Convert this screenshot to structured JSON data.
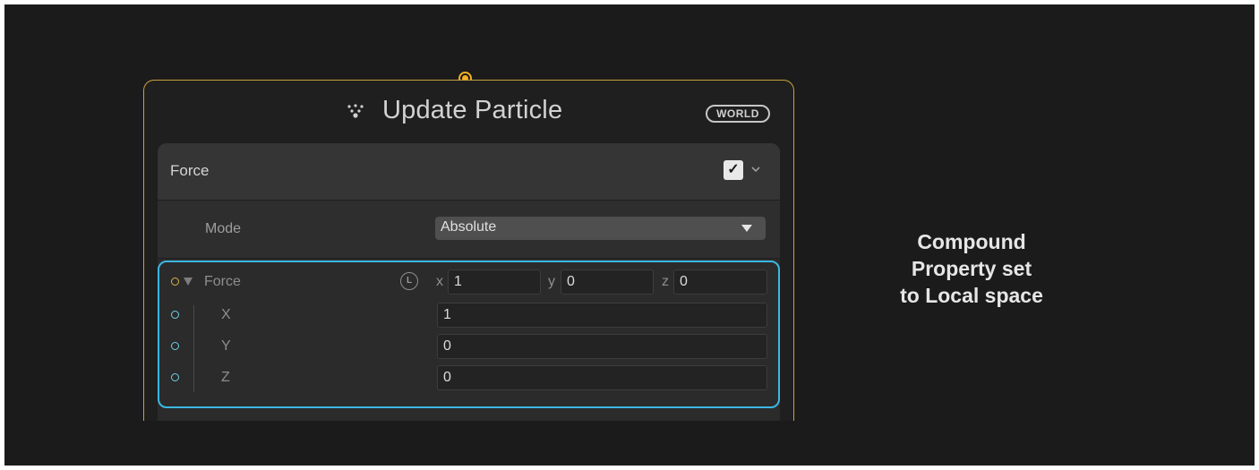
{
  "node": {
    "title": "Update Particle",
    "space_badge": "WORLD",
    "icon": "update-particle-icon",
    "accent_color": "#c9a23e"
  },
  "block": {
    "title": "Force",
    "enabled": true,
    "mode": {
      "label": "Mode",
      "value": "Absolute"
    },
    "force": {
      "label": "Force",
      "space_toggle": "L",
      "x_label": "x",
      "x": "1",
      "y_label": "y",
      "y": "0",
      "z_label": "z",
      "z": "0",
      "components": [
        {
          "label": "X",
          "value": "1"
        },
        {
          "label": "Y",
          "value": "0"
        },
        {
          "label": "Z",
          "value": "0"
        }
      ]
    },
    "highlight_color": "#3bb7e3"
  },
  "caption": {
    "line1": "Compound",
    "line2": "Property set",
    "line3": "to Local space"
  }
}
